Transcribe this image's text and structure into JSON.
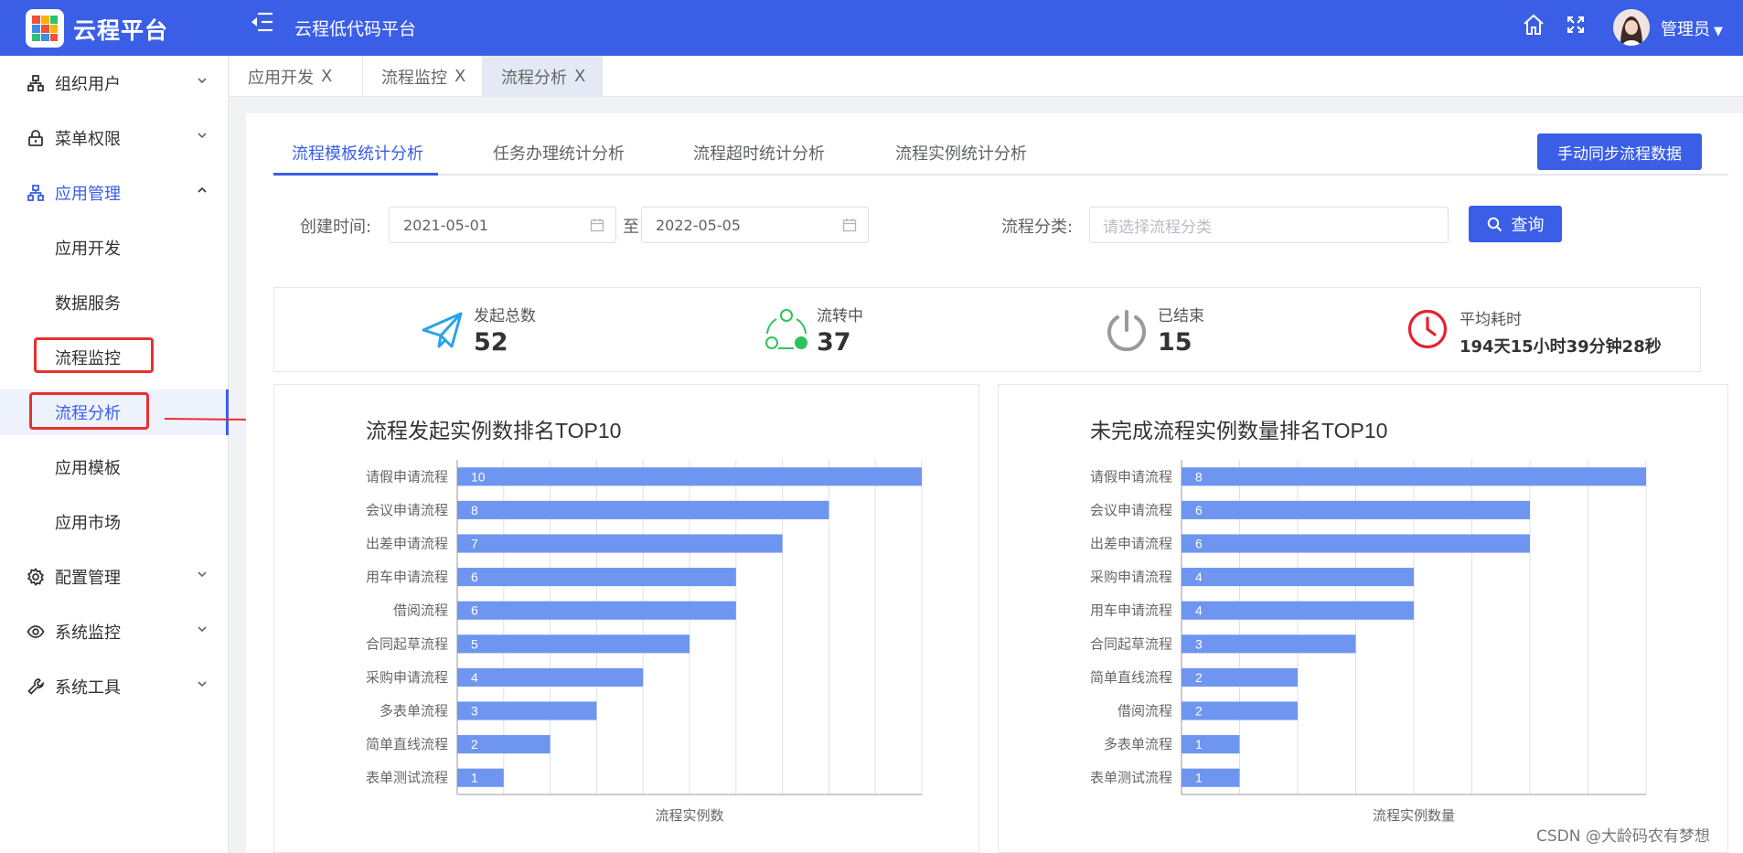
{
  "header": {
    "brand": "云程平台",
    "system_title": "云程低代码平台",
    "user_name": "管理员",
    "icons": [
      "menu-fold-icon",
      "home-icon",
      "fullscreen-icon",
      "caret-down-icon"
    ]
  },
  "sidebar": {
    "items": [
      {
        "label": "组织用户",
        "icon": "org-icon",
        "expanded": false
      },
      {
        "label": "菜单权限",
        "icon": "lock-icon",
        "expanded": false
      },
      {
        "label": "应用管理",
        "icon": "app-icon",
        "expanded": true
      },
      {
        "label": "配置管理",
        "icon": "gear-icon",
        "expanded": false
      },
      {
        "label": "系统监控",
        "icon": "eye-icon",
        "expanded": false
      },
      {
        "label": "系统工具",
        "icon": "wrench-icon",
        "expanded": false
      }
    ],
    "sub_items": [
      "应用开发",
      "数据服务",
      "流程监控",
      "流程分析",
      "应用模板",
      "应用市场"
    ],
    "active": "流程分析"
  },
  "tabs": [
    {
      "label": "应用开发",
      "close": "X"
    },
    {
      "label": "流程监控",
      "close": "X"
    },
    {
      "label": "流程分析",
      "close": "X"
    }
  ],
  "analysis_tabs": [
    "流程模板统计分析",
    "任务办理统计分析",
    "流程超时统计分析",
    "流程实例统计分析"
  ],
  "sync_button": "手动同步流程数据",
  "filters": {
    "created_label": "创建时间:",
    "date_from": "2021-05-01",
    "to_label": "至",
    "date_to": "2022-05-05",
    "category_label": "流程分类:",
    "category_placeholder": "请选择流程分类",
    "query_button": "查询"
  },
  "stats": [
    {
      "label": "发起总数",
      "value": "52",
      "icon": "send-icon",
      "color": "#29a3e8"
    },
    {
      "label": "流转中",
      "value": "37",
      "icon": "cycle-icon",
      "color": "#2fc25b"
    },
    {
      "label": "已结束",
      "value": "15",
      "icon": "power-icon",
      "color": "#999999"
    },
    {
      "label": "平均耗时",
      "value": "194天15小时39分钟28秒",
      "icon": "clock-icon",
      "color": "#e8212e"
    }
  ],
  "chart_data": [
    {
      "type": "bar",
      "orientation": "horizontal",
      "title": "流程发起实例数排名TOP10",
      "xlabel": "流程实例数",
      "categories": [
        "请假申请流程",
        "会议申请流程",
        "出差申请流程",
        "用车申请流程",
        "借阅流程",
        "合同起草流程",
        "采购申请流程",
        "多表单流程",
        "简单直线流程",
        "表单测试流程"
      ],
      "values": [
        10,
        8,
        7,
        6,
        6,
        5,
        4,
        3,
        2,
        1
      ],
      "xlim": [
        0,
        10
      ],
      "color": "#6e95f0"
    },
    {
      "type": "bar",
      "orientation": "horizontal",
      "title": "未完成流程实例数量排名TOP10",
      "xlabel": "流程实例数量",
      "categories": [
        "请假申请流程",
        "会议申请流程",
        "出差申请流程",
        "采购申请流程",
        "用车申请流程",
        "合同起草流程",
        "简单直线流程",
        "借阅流程",
        "多表单流程",
        "表单测试流程"
      ],
      "values": [
        8,
        6,
        6,
        4,
        4,
        3,
        2,
        2,
        1,
        1
      ],
      "xlim": [
        0,
        8
      ],
      "color": "#6e95f0"
    }
  ],
  "watermark": "CSDN @大龄码农有梦想"
}
